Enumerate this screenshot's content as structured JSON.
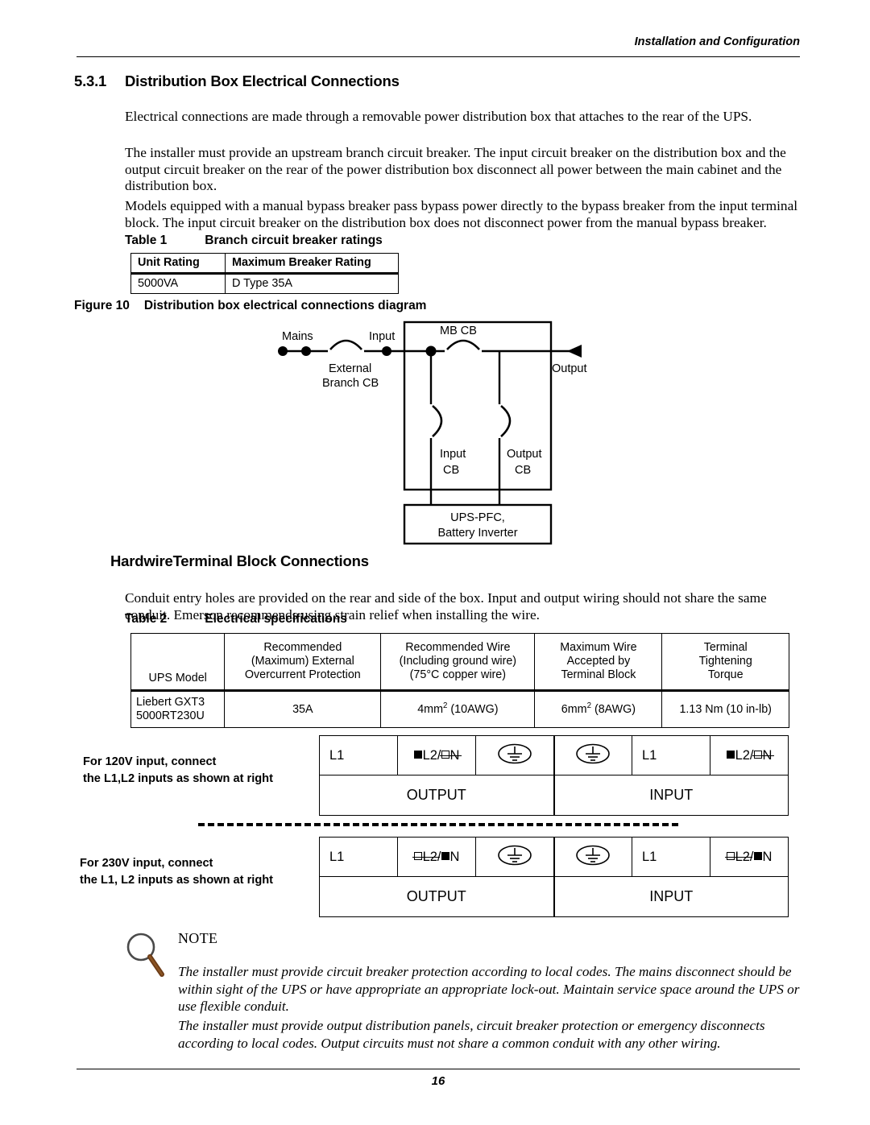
{
  "header": {
    "running_title": "Installation and Configuration"
  },
  "section": {
    "number": "5.3.1",
    "title": "Distribution Box Electrical Connections",
    "paragraphs": [
      "Electrical connections are made through a removable power distribution box that attaches to the rear of the UPS.",
      "The installer must provide an upstream branch circuit breaker. The input circuit breaker on the distribution box and the output circuit breaker on the rear of the power distribution box disconnect all power between the main cabinet and the distribution box.",
      "Models equipped with a manual bypass breaker pass bypass power directly to the bypass breaker from the input terminal block. The input circuit breaker on the distribution box does not disconnect power from the manual bypass breaker."
    ]
  },
  "table1": {
    "label": "Table 1",
    "title": "Branch circuit breaker ratings",
    "columns": [
      "Unit Rating",
      "Maximum Breaker Rating"
    ],
    "rows": [
      [
        "5000VA",
        "D Type 35A"
      ]
    ]
  },
  "figure10": {
    "label": "Figure 10",
    "title": "Distribution box electrical connections diagram",
    "labels": {
      "mains": "Mains",
      "external_branch_cb_line1": "External",
      "external_branch_cb_line2": "Branch CB",
      "input": "Input",
      "mb_cb": "MB CB",
      "output_arrow": "Output",
      "input_cb_line1": "Input",
      "input_cb_line2": "CB",
      "output_cb_line1": "Output",
      "output_cb_line2": "CB",
      "ups_box_line1": "UPS-PFC,",
      "ups_box_line2": "Battery Inverter"
    }
  },
  "hardwire": {
    "heading": "HardwireTerminal Block Connections",
    "paragraph": "Conduit entry holes are provided on the rear and side of the box. Input and output wiring should not share the same conduit. Emerson recommends using strain relief when installing the wire."
  },
  "table2": {
    "label": "Table 2",
    "title": "Electrical specifications",
    "columns": [
      "UPS Model",
      [
        "Recommended",
        "(Maximum) External",
        "Overcurrent Protection"
      ],
      [
        "Recommended Wire",
        "(Including ground wire)",
        "(75°C copper wire)"
      ],
      [
        "Maximum Wire",
        "Accepted by",
        "Terminal Block"
      ],
      [
        "Terminal",
        "Tightening",
        "Torque"
      ]
    ],
    "rows": [
      {
        "model_line1": "Liebert GXT3",
        "model_line2": "5000RT230U",
        "overcurrent": "35A",
        "recommended_wire_value": "4mm",
        "recommended_wire_sup": "2",
        "recommended_wire_tail": "(10AWG)",
        "max_wire_value": "6mm",
        "max_wire_sup": "2",
        "max_wire_tail": "(8AWG)",
        "torque": "1.13 Nm (10 in-lb)"
      }
    ]
  },
  "terminal_blocks": {
    "note_120_line1": "For 120V input, connect",
    "note_120_line2": "the L1,L2 inputs as shown at right",
    "note_230_line1": "For 230V input, connect",
    "note_230_line2": "the L1, L2 inputs as shown at right",
    "l1": "L1",
    "l2": "L2",
    "slash": "/",
    "n": "N",
    "output": "OUTPUT",
    "input": "INPUT",
    "ground_icon": "earth-ground-icon"
  },
  "note": {
    "icon": "magnifier-icon",
    "title": "NOTE",
    "paragraphs": [
      "The installer must provide circuit breaker protection according to local codes. The mains disconnect should be within sight of the UPS or have appropriate an appropriate lock-out. Maintain service space around the UPS or use flexible conduit.",
      "The installer must provide output distribution panels, circuit breaker protection or emergency disconnects according to local codes. Output circuits must not share a common conduit with any other wiring."
    ]
  },
  "footer": {
    "page_number": "16"
  }
}
